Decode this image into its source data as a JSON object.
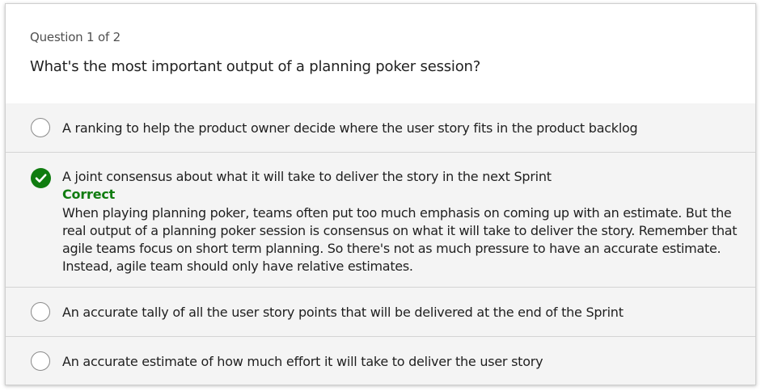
{
  "question": {
    "counter": "Question 1 of 2",
    "title": "What's the most important output of a planning poker session?"
  },
  "options": [
    {
      "label": "A ranking to help the product owner decide where the user story fits in the product backlog",
      "selected": false
    },
    {
      "label": "A joint consensus about what it will take to deliver the story in the next Sprint",
      "selected": true,
      "feedback_status": "Correct",
      "feedback_text": "When playing planning poker, teams often put too much emphasis on coming up with an estimate. But the real output of a planning poker session is consensus on what it will take to deliver the story. Remember that agile teams focus on short term planning. So there's not as much pressure to have an accurate estimate. Instead, agile team should only have relative estimates."
    },
    {
      "label": "An accurate tally of all the user story points that will be delivered at the end of the Sprint",
      "selected": false
    },
    {
      "label": "An accurate estimate of how much effort it will take to deliver the user story",
      "selected": false
    }
  ],
  "colors": {
    "correct_green": "#107c10",
    "option_background": "#f4f4f4",
    "divider": "#d4d4d4"
  },
  "icons": {
    "selected": "checkmark-circle-icon",
    "unselected": "radio-circle-icon"
  }
}
